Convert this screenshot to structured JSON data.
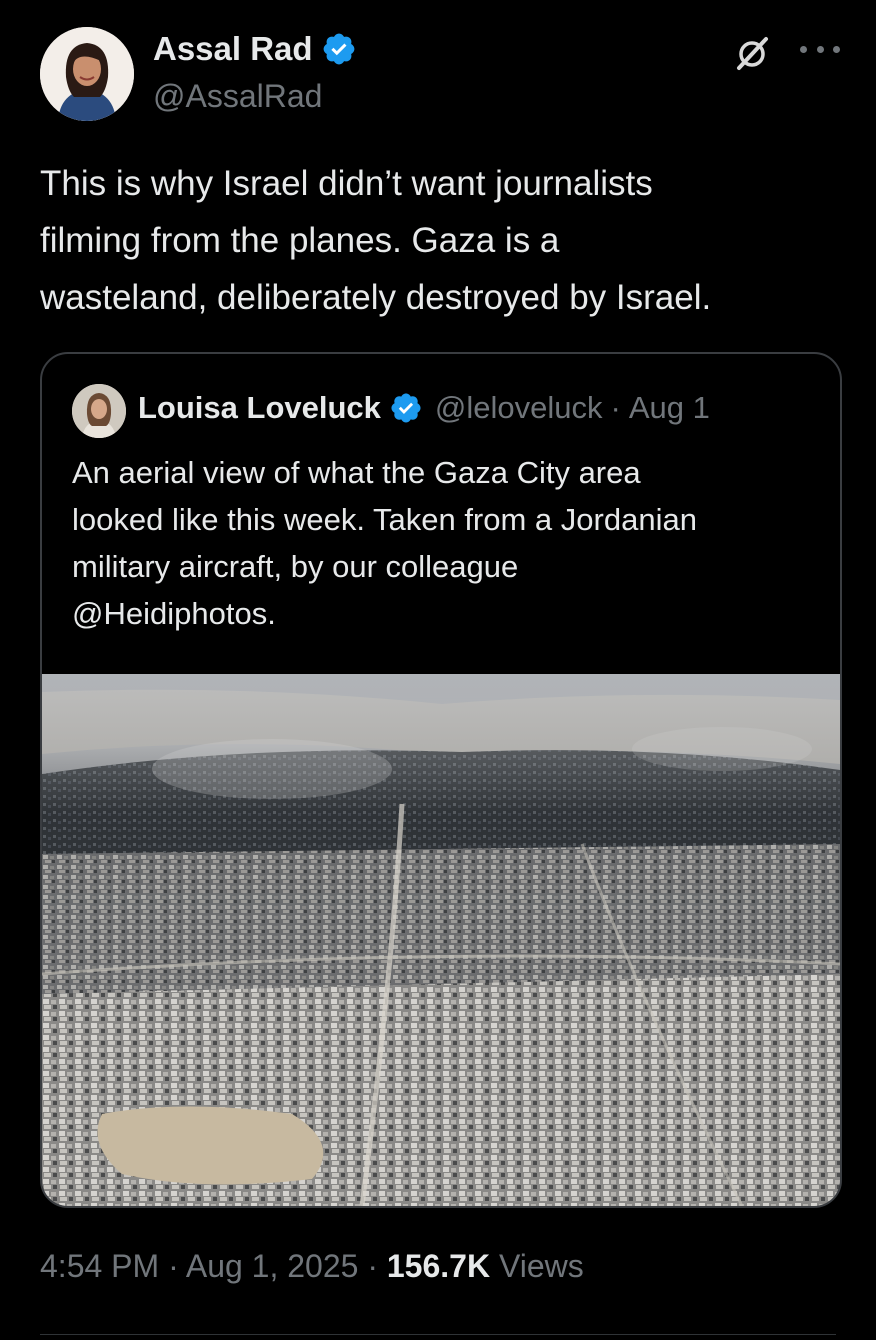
{
  "author": {
    "name": "Assal Rad",
    "handle": "@AssalRad"
  },
  "header_icons": [
    "grok-icon",
    "more-icon"
  ],
  "tweet": {
    "text": "This is why Israel didn’t want journalists\nfilming from the planes. Gaza is a\nwasteland, deliberately destroyed by Israel."
  },
  "quoted": {
    "name": "Louisa Loveluck",
    "handle": "@leloveluck",
    "separator": "·",
    "date": "Aug 1",
    "text": "An aerial view of what the Gaza City area\nlooked like this week. Taken from a Jordanian\nmilitary aircraft, by our colleague\n@Heidiphotos.",
    "image_icon": "aerial-city-photo"
  },
  "meta": {
    "time": "4:54 PM",
    "sep1": " · ",
    "date": "Aug 1, 2025",
    "sep2": " · ",
    "views_count": "156.7K",
    "views_label": " Views"
  },
  "colors": {
    "background": "#000000",
    "text_primary": "#e7e9ea",
    "text_secondary": "#71767b",
    "verified_blue": "#1d9bf0",
    "card_border": "#3a3d41"
  }
}
